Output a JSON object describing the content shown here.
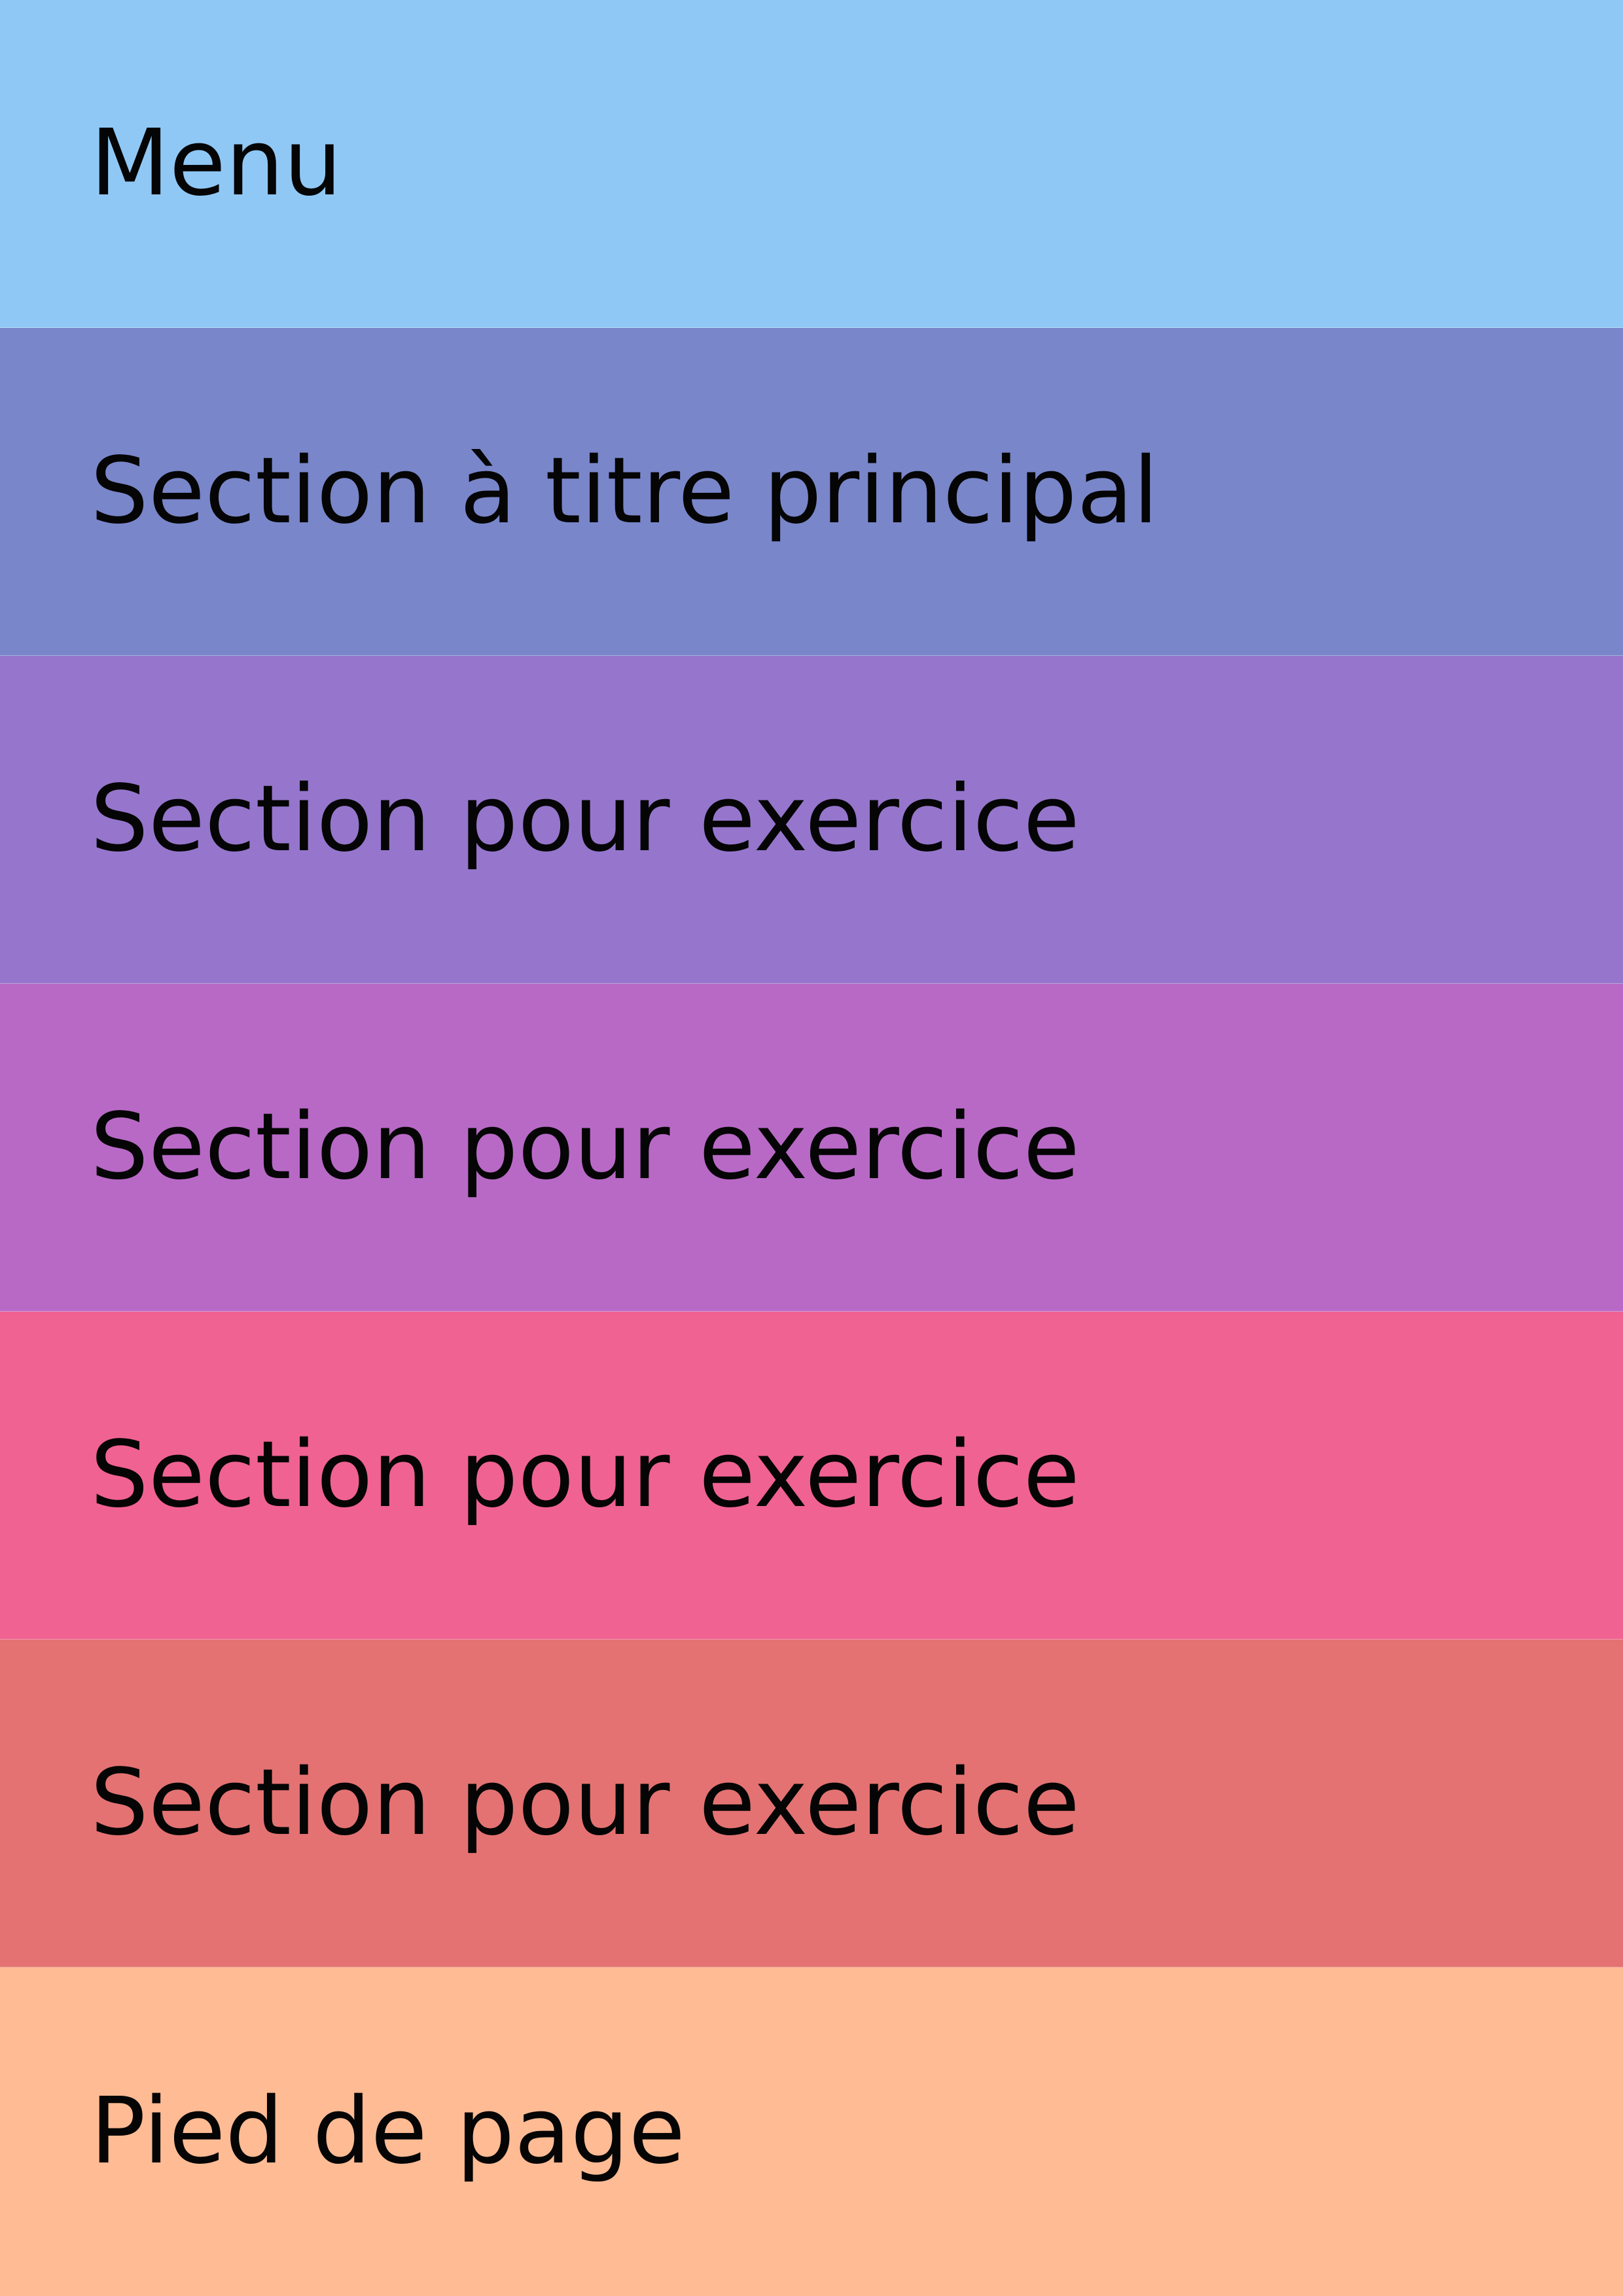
{
  "sections": [
    {
      "id": "menu",
      "label": "Menu",
      "color": "#90c8f5"
    },
    {
      "id": "main-title",
      "label": "Section à titre principal",
      "color": "#7986ca"
    },
    {
      "id": "exercise-1",
      "label": "Section pour exercice",
      "color": "#9576cc"
    },
    {
      "id": "exercise-2",
      "label": "Section pour exercice",
      "color": "#b869c6"
    },
    {
      "id": "exercise-3",
      "label": "Section pour exercice",
      "color": "#f06291"
    },
    {
      "id": "exercise-4",
      "label": "Section pour exercice",
      "color": "#e47272"
    },
    {
      "id": "footer",
      "label": "Pied de page",
      "color": "#ffbb94"
    }
  ]
}
